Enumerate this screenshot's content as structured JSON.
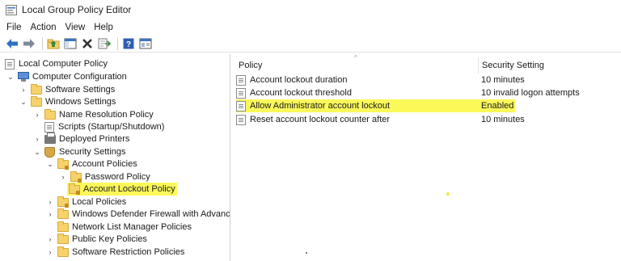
{
  "window": {
    "title": "Local Group Policy Editor"
  },
  "menu": [
    "File",
    "Action",
    "View",
    "Help"
  ],
  "toolbar": {
    "buttons": [
      "back-arrow-icon",
      "forward-arrow-icon",
      "up-folder-icon",
      "show-hide-tree-icon",
      "delete-icon",
      "export-list-icon",
      "help-icon",
      "properties-icon"
    ]
  },
  "tree": {
    "root": "Local Computer Policy",
    "computer_configuration": "Computer Configuration",
    "software_settings": "Software Settings",
    "windows_settings": "Windows Settings",
    "name_resolution_policy": "Name Resolution Policy",
    "scripts": "Scripts (Startup/Shutdown)",
    "deployed_printers": "Deployed Printers",
    "security_settings": "Security Settings",
    "account_policies": "Account Policies",
    "password_policy": "Password Policy",
    "account_lockout_policy": "Account Lockout Policy",
    "local_policies": "Local Policies",
    "windows_defender_firewall": "Windows Defender Firewall with Advanced",
    "network_list_manager": "Network List Manager Policies",
    "public_key_policies": "Public Key Policies",
    "software_restriction": "Software Restriction Policies"
  },
  "details": {
    "columns": {
      "policy": "Policy",
      "security_setting": "Security Setting"
    },
    "rows": [
      {
        "policy": "Account lockout duration",
        "setting": "10 minutes"
      },
      {
        "policy": "Account lockout threshold",
        "setting": "10 invalid logon attempts"
      },
      {
        "policy": "Allow Administrator account lockout",
        "setting": "Enabled",
        "highlighted": true
      },
      {
        "policy": "Reset account lockout counter after",
        "setting": "10 minutes"
      }
    ]
  },
  "colors": {
    "highlight": "#fbf85a",
    "folder": "#f6d26b"
  }
}
